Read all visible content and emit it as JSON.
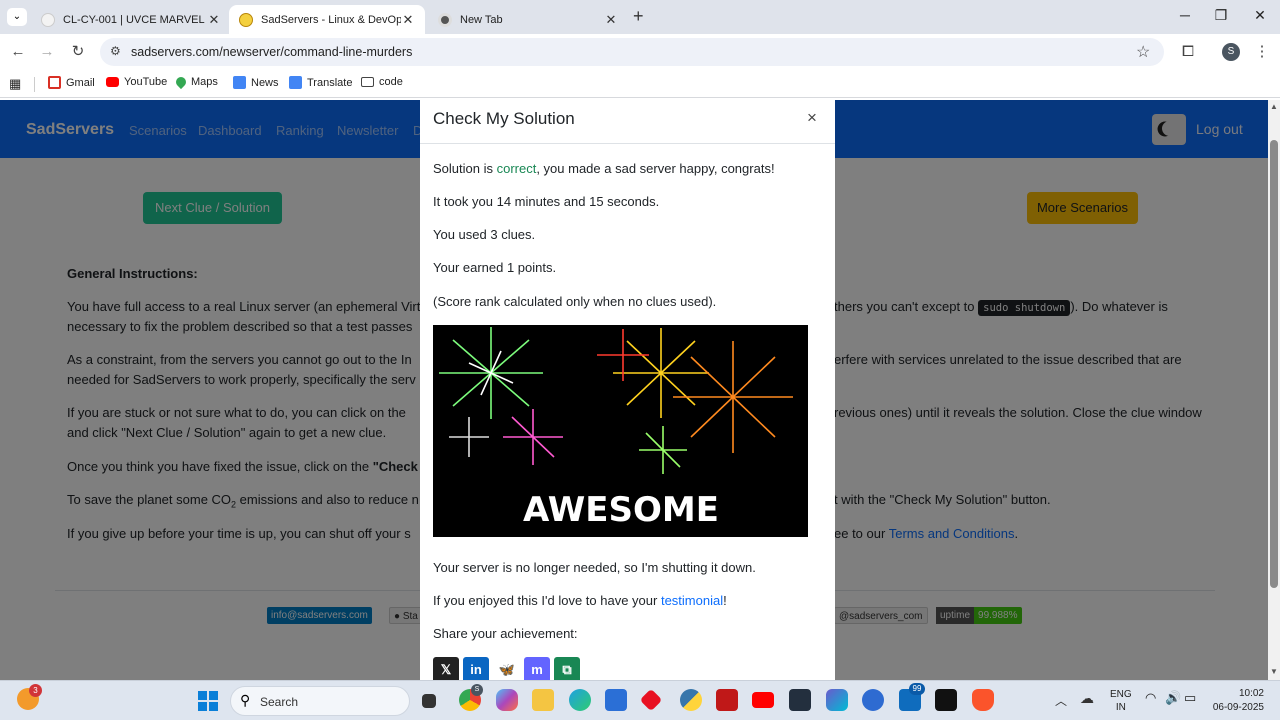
{
  "browser": {
    "tabs": [
      {
        "title": "CL-CY-001 | UVCE MARVEL",
        "close": "✕"
      },
      {
        "title": "SadServers - Linux & DevOps Tr",
        "close": "✕"
      },
      {
        "title": "New Tab",
        "close": "✕"
      }
    ],
    "new_tab": "+",
    "window_controls": {
      "minimize": "─",
      "maximize": "❐",
      "close": "✕"
    },
    "url": "sadservers.com/newserver/command-line-murders",
    "profile_initial": "S",
    "bookmarks": [
      {
        "label": "Gmail",
        "icon": "gmail-icon"
      },
      {
        "label": "YouTube",
        "icon": "youtube-icon"
      },
      {
        "label": "Maps",
        "icon": "maps-icon"
      },
      {
        "label": "News",
        "icon": "news-icon"
      },
      {
        "label": "Translate",
        "icon": "translate-icon"
      },
      {
        "label": "code",
        "icon": "folder-icon"
      }
    ]
  },
  "site": {
    "brand": "SadServers",
    "nav": [
      "Scenarios",
      "Dashboard",
      "Ranking",
      "Newsletter",
      "D"
    ],
    "logout": "Log out",
    "next_clue_button": "Next Clue / Solution",
    "more_scenarios_button": "More Scenarios",
    "general_heading": "General Instructions:",
    "p1a": "You have full access to a real Linux server (an ephemeral Virt",
    "p1b": "thers you can't except to",
    "p1code": "sudo shutdown",
    "p1c": "). Do whatever is",
    "p1d": "necessary to fix the problem described so that a test passes",
    "p2a": "As a constraint, from the servers you cannot go out to the In",
    "p2b": "erfere with services unrelated to the issue described that are",
    "p2c": "needed for SadServers to work properly, specifically the serv",
    "p3a": "If you are stuck or not sure what to do, you can click on the",
    "p3b": "revious ones) until it reveals the solution. Close the clue window",
    "p3c": "and click \"Next Clue / Solution\" again to get a new clue.",
    "p4a": "Once you think you have fixed the issue, click on the",
    "p4b": "\"Check",
    "p5a": "To save the planet some CO",
    "p5sub": "2",
    "p5b": "emissions and also to reduce n",
    "p5c": "t with the \"Check My Solution\" button.",
    "p6a": "If you give up before your time is up, you can shut off your s",
    "p6b": "ee to our",
    "p6link": "Terms and Conditions",
    "p6c": ".",
    "footer_email": "info@sadservers.com",
    "footer_github": "Sta",
    "footer_twitter": "@sadservers_com",
    "uptime_label": "uptime",
    "uptime_value": "99.988%"
  },
  "modal": {
    "title": "Check My Solution",
    "close": "×",
    "l1a": "Solution is ",
    "l1b": "correct",
    "l1c": ", you made a sad server happy, congrats!",
    "l2": "It took you 14 minutes and 15 seconds.",
    "l3": "You used 3 clues.",
    "l4": "Your earned 1 points.",
    "l5": "(Score rank calculated only when no clues used).",
    "image_text": "AWESOME",
    "l6": "Your server is no longer needed, so I'm shutting it down.",
    "l7a": "If you enjoyed this I'd love to have your ",
    "l7b": "testimonial",
    "l7c": "!",
    "l8": "Share your achievement:",
    "share": [
      {
        "icon": "x-icon",
        "glyph": "𝕏",
        "color": "#222222"
      },
      {
        "icon": "linkedin-icon",
        "glyph": "in",
        "color": "#0a66c2"
      },
      {
        "icon": "bluesky-icon",
        "glyph": "🦋",
        "color": "#ffffff"
      },
      {
        "icon": "mastodon-icon",
        "glyph": "m",
        "color": "#6364ff"
      },
      {
        "icon": "copy-icon",
        "glyph": "⧉",
        "color": "#198754"
      }
    ]
  },
  "taskbar": {
    "weather_badge": "3",
    "search_placeholder": "Search",
    "chrome_badge": "S",
    "store_badge": "99",
    "lang_top": "ENG",
    "lang_bottom": "IN",
    "time": "10:02",
    "date": "06-09-2025"
  },
  "colors": {
    "navbar": "#0d6efd",
    "next_button": "#20c997",
    "more_button": "#ffc107",
    "success": "#198754",
    "uptime": "#4c1"
  }
}
